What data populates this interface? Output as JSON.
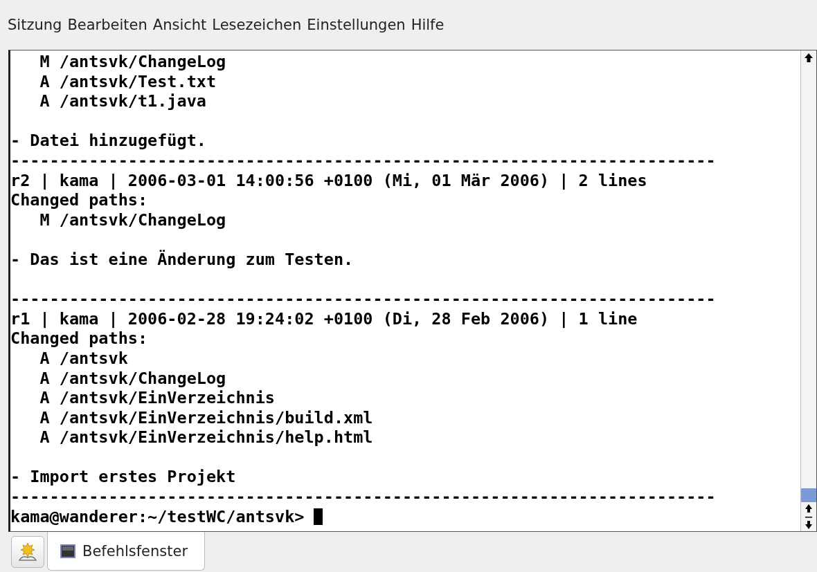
{
  "menu_bar": {
    "items": [
      "Sitzung",
      "Bearbeiten",
      "Ansicht",
      "Lesezeichen",
      "Einstellungen",
      "Hilfe"
    ]
  },
  "terminal": {
    "lines": [
      {
        "kind": "text",
        "text": "   M /antsvk/ChangeLog"
      },
      {
        "kind": "text",
        "text": "   A /antsvk/Test.txt"
      },
      {
        "kind": "text",
        "text": "   A /antsvk/t1.java"
      },
      {
        "kind": "blank"
      },
      {
        "kind": "text",
        "text": "- Datei hinzugefügt."
      },
      {
        "kind": "text",
        "text": "------------------------------------------------------------------------"
      },
      {
        "kind": "text",
        "text": "r2 | kama | 2006-03-01 14:00:56 +0100 (Mi, 01 Mär 2006) | 2 lines"
      },
      {
        "kind": "text",
        "text": "Changed paths:"
      },
      {
        "kind": "text",
        "text": "   M /antsvk/ChangeLog"
      },
      {
        "kind": "blank"
      },
      {
        "kind": "text",
        "text": "- Das ist eine Änderung zum Testen."
      },
      {
        "kind": "blank"
      },
      {
        "kind": "text",
        "text": "------------------------------------------------------------------------"
      },
      {
        "kind": "text",
        "text": "r1 | kama | 2006-02-28 19:24:02 +0100 (Di, 28 Feb 2006) | 1 line"
      },
      {
        "kind": "text",
        "text": "Changed paths:"
      },
      {
        "kind": "text",
        "text": "   A /antsvk"
      },
      {
        "kind": "text",
        "text": "   A /antsvk/ChangeLog"
      },
      {
        "kind": "text",
        "text": "   A /antsvk/EinVerzeichnis"
      },
      {
        "kind": "text",
        "text": "   A /antsvk/EinVerzeichnis/build.xml"
      },
      {
        "kind": "text",
        "text": "   A /antsvk/EinVerzeichnis/help.html"
      },
      {
        "kind": "blank"
      },
      {
        "kind": "text",
        "text": "- Import erstes Projekt"
      },
      {
        "kind": "text",
        "text": "------------------------------------------------------------------------"
      },
      {
        "kind": "prompt",
        "text": "kama@wanderer:~/testWC/antsvk>"
      }
    ]
  },
  "tabs": [
    {
      "label": "Befehlsfenster",
      "selected": true
    }
  ]
}
